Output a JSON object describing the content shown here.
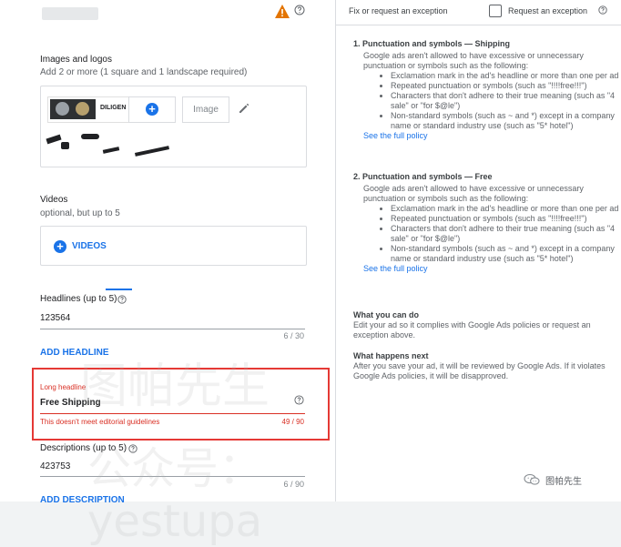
{
  "left": {
    "images": {
      "title": "Images and logos",
      "subtitle": "Add 2 or more (1 square and 1 landscape required)",
      "brand_text": "DILIGEN",
      "placeholder_label": "Image"
    },
    "videos": {
      "title": "Videos",
      "subtitle": "optional, but up to 5",
      "button_label": "VIDEOS"
    },
    "headlines": {
      "label": "Headlines (up to 5)",
      "value": "123564",
      "counter": "6 / 30",
      "add_label": "ADD HEADLINE"
    },
    "long_headline": {
      "label": "Long headline",
      "value": "Free Shipping",
      "error": "This doesn't meet editorial guidelines",
      "counter": "49 / 90"
    },
    "descriptions": {
      "label": "Descriptions (up to 5)",
      "value": "423753",
      "counter": "6 / 90",
      "add_label": "ADD DESCRIPTION"
    }
  },
  "right": {
    "header": {
      "fix_label": "Fix or request an exception",
      "request_label": "Request an exception"
    },
    "policies": [
      {
        "title": "1. Punctuation and symbols — Shipping",
        "description": "Google ads aren't allowed to have excessive or unnecessary punctuation or symbols such as the following:",
        "bullets": [
          "Exclamation mark in the ad's headline or more than one per ad",
          "Repeated punctuation or symbols (such as \"!!!!free!!!\")",
          "Characters that don't adhere to their true meaning (such as \"4 sale\" or \"for $@le\")",
          "Non-standard symbols (such as ~ and *) except in a company name or standard industry use (such as \"5* hotel\")"
        ],
        "link": "See the full policy"
      },
      {
        "title": "2. Punctuation and symbols — Free",
        "description": "Google ads aren't allowed to have excessive or unnecessary punctuation or symbols such as the following:",
        "bullets": [
          "Exclamation mark in the ad's headline or more than one per ad",
          "Repeated punctuation or symbols (such as \"!!!!free!!!\")",
          "Characters that don't adhere to their true meaning (such as \"4 sale\" or \"for $@le\")",
          "Non-standard symbols (such as ~ and *) except in a company name or standard industry use (such as \"5* hotel\")"
        ],
        "link": "See the full policy"
      }
    ],
    "what_you_can_do": {
      "title": "What you can do",
      "text": "Edit your ad so it complies with Google Ads policies or request an exception above."
    },
    "what_happens_next": {
      "title": "What happens next",
      "text": "After you save your ad, it will be reviewed by Google Ads. If it violates Google Ads policies, it will be disapproved."
    }
  },
  "watermark": {
    "label": "图帕先生",
    "background_line_1": "图帕先生",
    "background_line_2": "公众号：yestupa"
  },
  "colors": {
    "accent": "#1a73e8",
    "error": "#d93025",
    "warning": "#e37400",
    "highlight_box": "#e53935"
  },
  "icons": {
    "warning": "warning-triangle-icon",
    "help": "help-circle-icon",
    "edit": "pencil-icon",
    "plus": "plus-circle-icon",
    "checkbox": "checkbox-icon",
    "watermark": "wechat-icon"
  }
}
